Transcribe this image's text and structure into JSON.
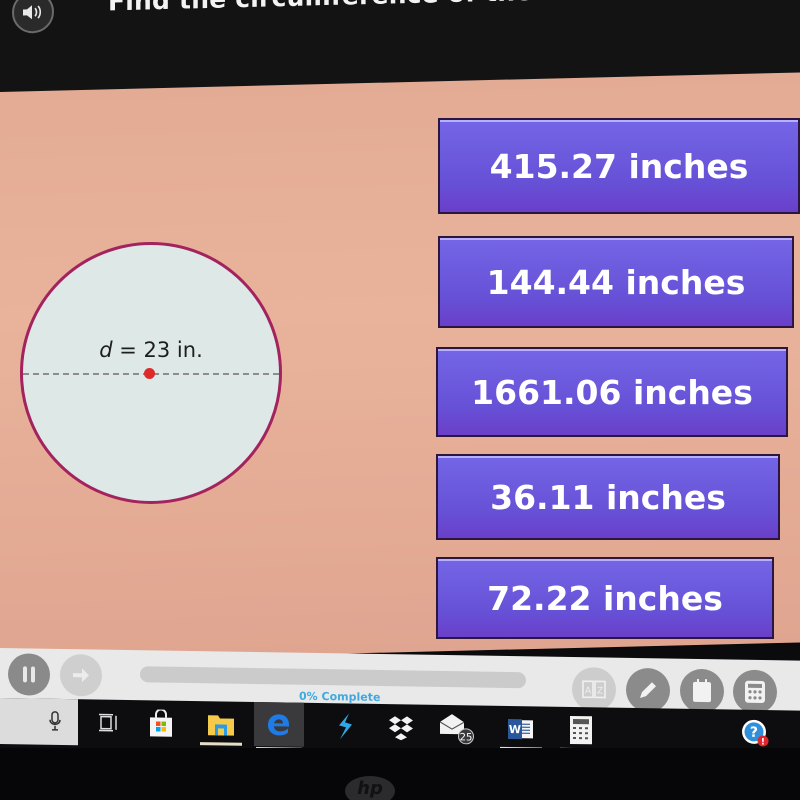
{
  "header": {
    "question": "Find the circumference of the circle.",
    "speaker_icon": "speaker-icon"
  },
  "figure": {
    "label_var": "d",
    "label_rest": " = 23 in.",
    "diameter_value": 23,
    "diameter_unit": "in.",
    "colors": {
      "fill": "#dde8e7",
      "stroke": "#a3235e",
      "center_dot": "#e02a2a"
    }
  },
  "answers": [
    {
      "label": "415.27 inches"
    },
    {
      "label": "144.44 inches"
    },
    {
      "label": "1661.06 inches"
    },
    {
      "label": "36.11 inches"
    },
    {
      "label": "72.22 inches"
    }
  ],
  "toolbar": {
    "pause_icon": "pause-icon",
    "next_icon": "arrow-right-icon",
    "progress_percent": 0,
    "progress_label": "0% Complete",
    "tools": [
      "glossary-icon",
      "pencil-icon",
      "notepad-icon",
      "calculator-icon"
    ]
  },
  "taskbar": {
    "items": [
      {
        "name": "microphone-icon"
      },
      {
        "name": "task-view-icon"
      },
      {
        "name": "store-icon"
      },
      {
        "name": "file-explorer-icon"
      },
      {
        "name": "edge-icon"
      },
      {
        "name": "app-bolt-icon"
      },
      {
        "name": "dropbox-icon"
      },
      {
        "name": "mail-icon",
        "badge": "25"
      },
      {
        "name": "word-icon"
      },
      {
        "name": "calculator-app-icon"
      },
      {
        "name": "help-icon"
      }
    ]
  },
  "colors": {
    "accent_purple": "#6650d6",
    "background_peach": "#e9b39b",
    "progress_text": "#3fa9e0"
  }
}
